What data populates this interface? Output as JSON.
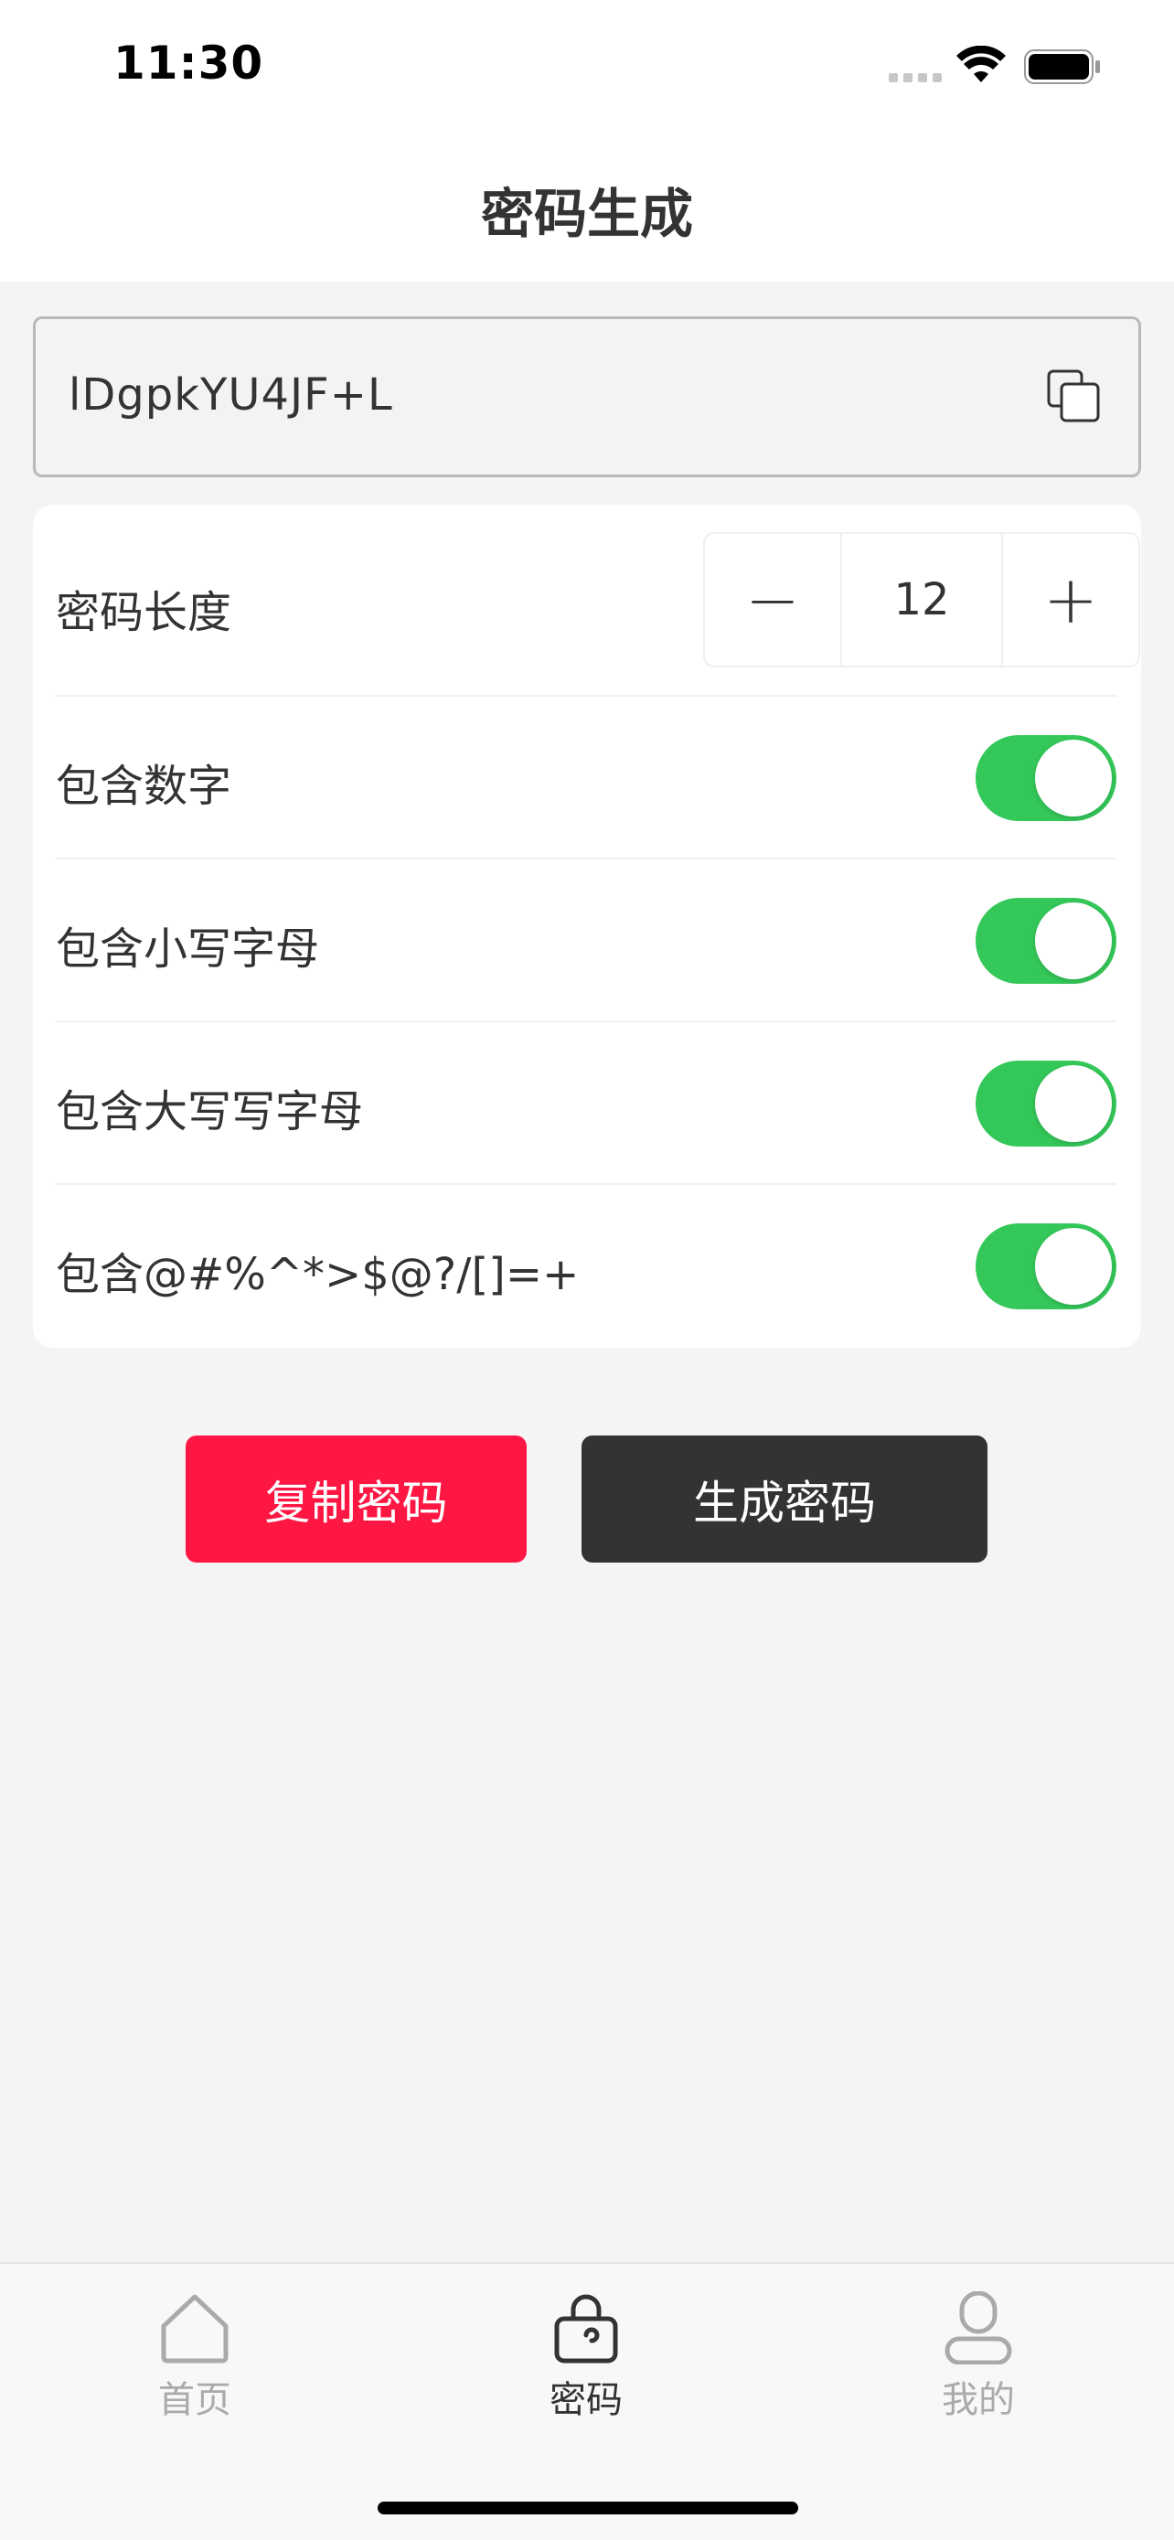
{
  "status": {
    "time": "11:30"
  },
  "nav": {
    "title": "密码生成"
  },
  "password": {
    "value": "lDgpkYU4JF+L",
    "copy_icon": "copy-icon"
  },
  "settings": {
    "length_label": "密码长度",
    "length_value": "12",
    "decrement": "−",
    "increment": "+",
    "toggles": [
      {
        "label": "包含数字",
        "on": true
      },
      {
        "label": "包含小写字母",
        "on": true
      },
      {
        "label": "包含大写写字母",
        "on": true
      },
      {
        "label": "包含@#%^*>$@?/[]=+",
        "on": true
      }
    ]
  },
  "actions": {
    "copy_label": "复制密码",
    "generate_label": "生成密码"
  },
  "tabbar": {
    "items": [
      {
        "label": "首页",
        "icon": "home-icon",
        "active": false
      },
      {
        "label": "密码",
        "icon": "lock-icon",
        "active": true
      },
      {
        "label": "我的",
        "icon": "person-icon",
        "active": false
      }
    ]
  },
  "colors": {
    "accent_red": "#ff1744",
    "dark_button": "#333333",
    "toggle_on": "#34c759"
  }
}
